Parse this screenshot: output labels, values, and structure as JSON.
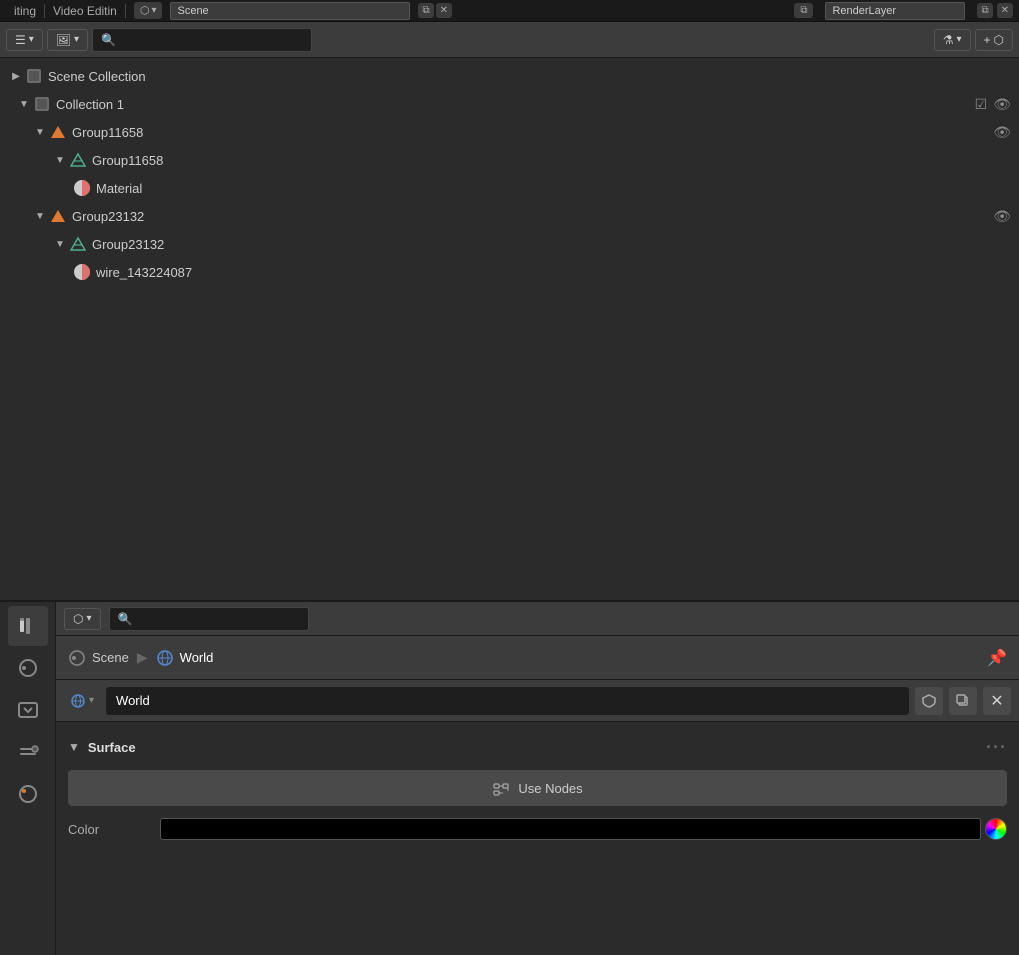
{
  "topHeader": {
    "items": [
      "iting",
      "Video Editin"
    ],
    "sceneLabel": "Scene",
    "renderLayerLabel": "RenderLayer"
  },
  "outliner": {
    "searchPlaceholder": "",
    "sceneCollection": "Scene Collection",
    "collection1": "Collection 1",
    "groups": [
      {
        "id": "Group11658",
        "name": "Group11658",
        "children": [
          {
            "name": "Group11658",
            "material": "Material"
          }
        ]
      },
      {
        "id": "Group23132",
        "name": "Group23132",
        "children": [
          {
            "name": "Group23132",
            "material": "wire_143224087"
          }
        ]
      }
    ]
  },
  "propertiesPanel": {
    "searchPlaceholder": "",
    "breadcrumb": {
      "scene": "Scene",
      "world": "World"
    },
    "worldSelector": {
      "name": "World",
      "type": "World"
    },
    "surface": {
      "title": "Surface",
      "useNodesLabel": "Use Nodes",
      "colorLabel": "Color"
    }
  },
  "sidebar": {
    "icons": [
      {
        "name": "tools-icon",
        "symbol": "🔧",
        "active": true
      },
      {
        "name": "scene-icon",
        "symbol": "🎬"
      },
      {
        "name": "output-icon",
        "symbol": "📋"
      },
      {
        "name": "view-layer-icon",
        "symbol": "📷"
      },
      {
        "name": "world-scene-icon",
        "symbol": "🌍"
      }
    ]
  },
  "colors": {
    "accent_orange": "#e07a30",
    "accent_teal": "#4caf8a",
    "material_pink": "#e07070",
    "bg_dark": "#2b2b2b",
    "bg_toolbar": "#3c3c3c"
  }
}
